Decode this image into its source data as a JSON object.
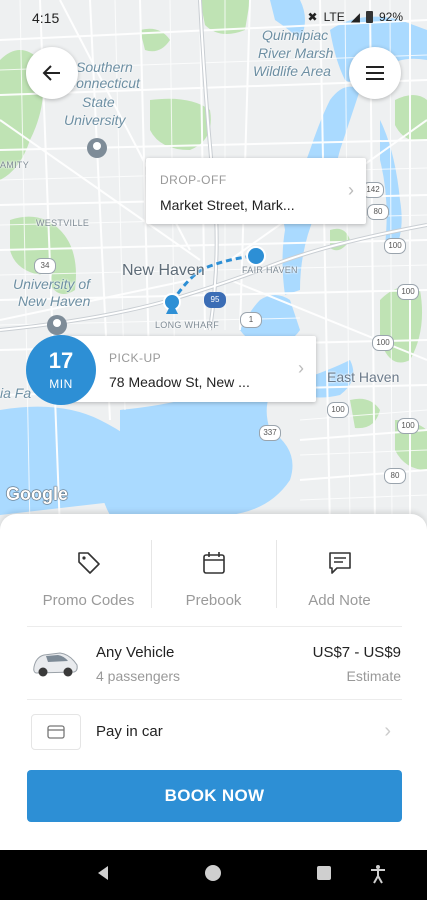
{
  "status_bar": {
    "time": "4:15",
    "network": "LTE",
    "battery": "92%"
  },
  "map": {
    "labels": {
      "southern": "Southern",
      "connecticut": "Connecticut",
      "state": "State",
      "university": "University",
      "quinnipiac": "Quinnipiac",
      "river_marsh": "River Marsh",
      "wildlife_area": "Wildlife Area",
      "westville": "WESTVILLE",
      "new_haven": "New Haven",
      "fair_haven": "FAIR HAVEN",
      "long_wharf": "LONG WHARF",
      "uni_new_haven_1": "University of",
      "uni_new_haven_2": "New Haven",
      "east_haven": "East Haven",
      "amity": "AMITY",
      "west_haven": "ia Fa",
      "google": "Google"
    },
    "road_shields": [
      "34",
      "1",
      "95",
      "1",
      "100",
      "80",
      "100",
      "337",
      "100",
      "1",
      "80",
      "100",
      "100",
      "142"
    ]
  },
  "dropoff": {
    "label": "DROP-OFF",
    "value": "Market Street, Mark..."
  },
  "pickup": {
    "label": "PICK-UP",
    "value": "78 Meadow St, New ..."
  },
  "eta": {
    "value": "17",
    "unit": "MIN"
  },
  "options": {
    "promo": "Promo Codes",
    "prebook": "Prebook",
    "note": "Add Note"
  },
  "vehicle": {
    "name": "Any Vehicle",
    "passengers": "4 passengers",
    "price": "US$7 - US$9",
    "price_note": "Estimate"
  },
  "payment": {
    "label": "Pay in car"
  },
  "book_button": "BOOK NOW",
  "colors": {
    "accent": "#2d8fd5",
    "park": "#bfe3b4",
    "water": "#aadaff"
  }
}
